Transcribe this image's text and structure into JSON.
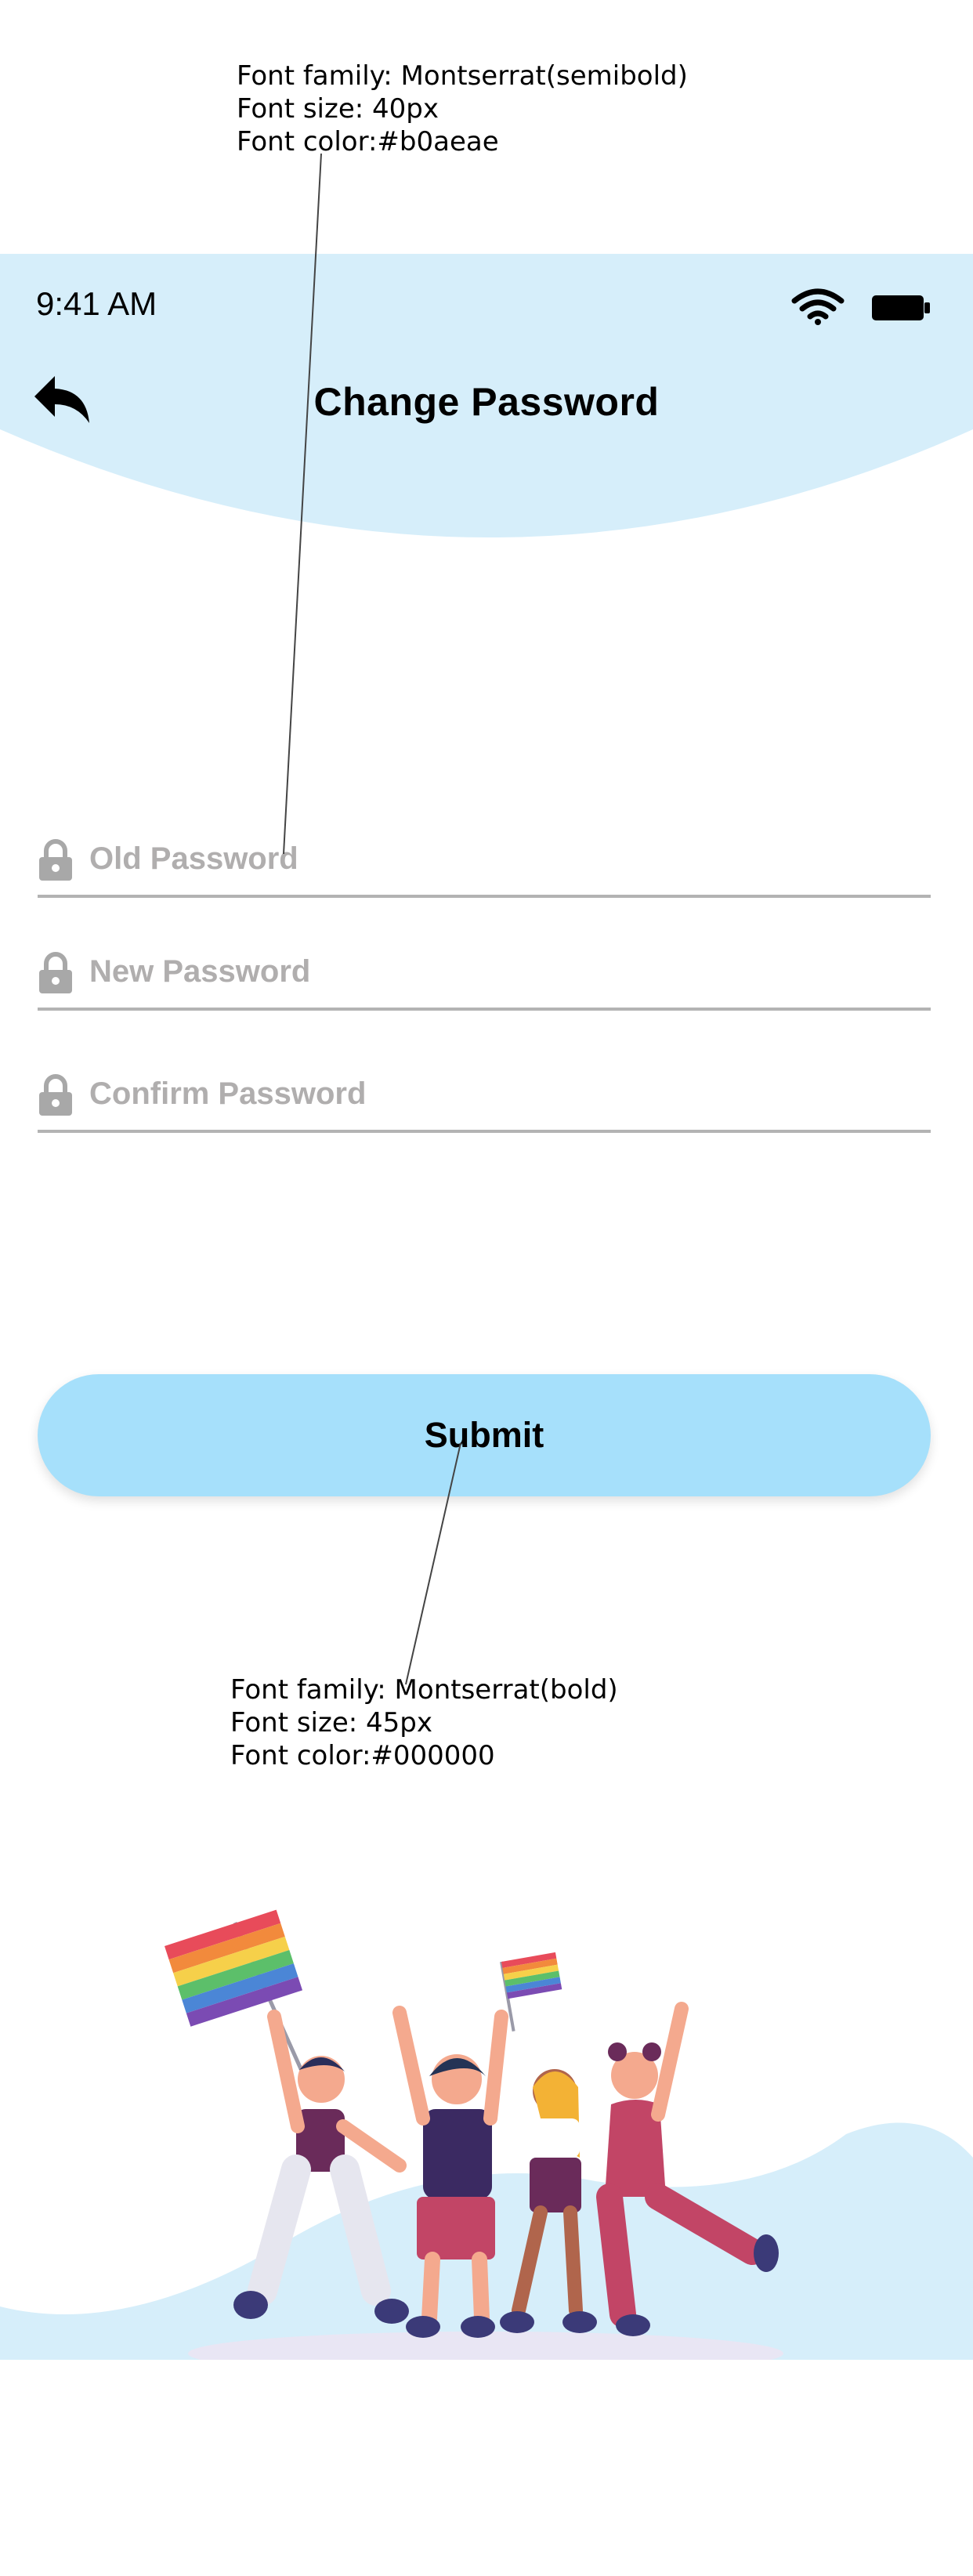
{
  "annotations": {
    "input_note": [
      "Font family: Montserrat(semibold)",
      "Font size: 40px",
      "Font color:#b0aeae"
    ],
    "button_note": [
      "Font family: Montserrat(bold)",
      "Font size: 45px",
      "Font color:#000000"
    ]
  },
  "status_bar": {
    "time": "9:41 AM",
    "icons": [
      "wifi-icon",
      "battery-icon"
    ]
  },
  "header": {
    "title": "Change Password",
    "back_icon": "back-arrow-icon"
  },
  "form": {
    "fields": [
      {
        "placeholder": "Old Password",
        "icon": "lock-icon"
      },
      {
        "placeholder": "New Password",
        "icon": "lock-icon"
      },
      {
        "placeholder": "Confirm Password",
        "icon": "lock-icon"
      }
    ],
    "submit_label": "Submit"
  },
  "colors": {
    "header_bg": "#d6eefa",
    "button_bg": "#a6e0fb",
    "placeholder": "#b0aeae",
    "underline": "#b3b3b3",
    "text": "#000000"
  }
}
